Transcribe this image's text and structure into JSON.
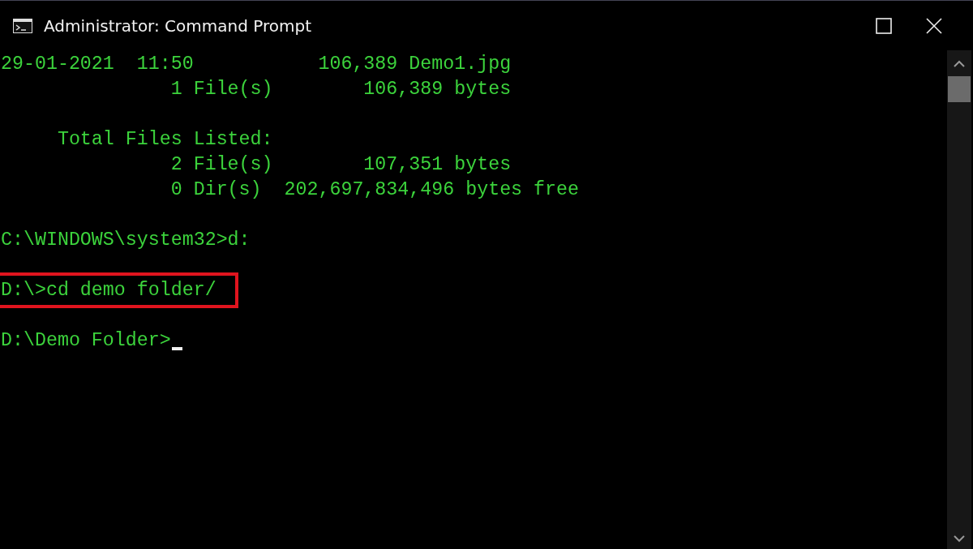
{
  "window": {
    "title": "Administrator: Command Prompt"
  },
  "console": {
    "blocks": [
      {
        "lines": [
          {
            "text": "29-01-2021  11:50           106,389 Demo1.jpg",
            "highlighted": false,
            "cursor": false
          },
          {
            "text": "               1 File(s)        106,389 bytes",
            "highlighted": false,
            "cursor": false
          }
        ]
      },
      {
        "lines": [
          {
            "text": "     Total Files Listed:",
            "highlighted": false,
            "cursor": false
          },
          {
            "text": "               2 File(s)        107,351 bytes",
            "highlighted": false,
            "cursor": false
          },
          {
            "text": "               0 Dir(s)  202,697,834,496 bytes free",
            "highlighted": false,
            "cursor": false
          }
        ]
      },
      {
        "lines": [
          {
            "text": "C:\\WINDOWS\\system32>d:",
            "highlighted": false,
            "cursor": false
          }
        ]
      },
      {
        "lines": [
          {
            "text": "D:\\>cd demo folder/",
            "highlighted": true,
            "cursor": false
          }
        ]
      },
      {
        "lines": [
          {
            "text": "D:\\Demo Folder>",
            "highlighted": false,
            "cursor": true
          }
        ]
      }
    ]
  }
}
